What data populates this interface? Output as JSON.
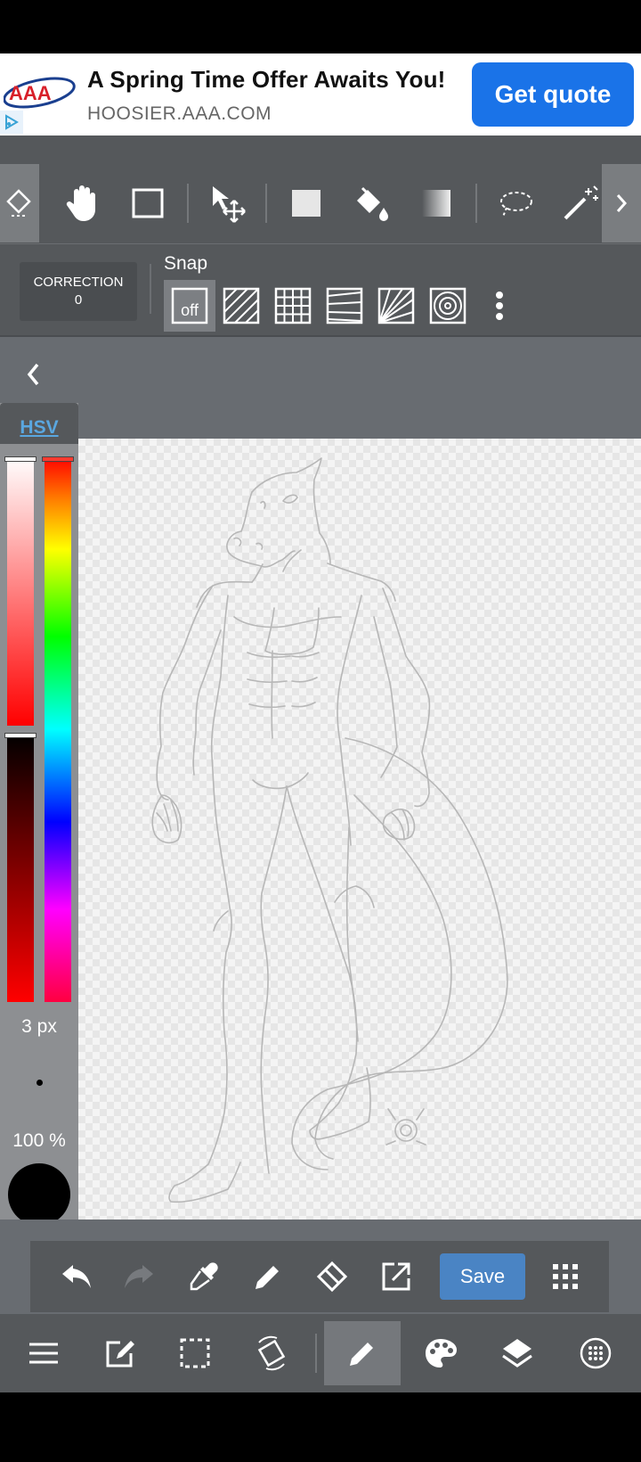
{
  "ad": {
    "title": "A Spring Time Offer Awaits You!",
    "url": "HOOSIER.AAA.COM",
    "button": "Get quote",
    "brand_color": "#1a73e8"
  },
  "toolbar": {
    "tools": [
      "hand-icon",
      "rectangle-select-icon",
      "move-icon",
      "fill-rect-icon",
      "bucket-icon",
      "gradient-icon",
      "lasso-icon",
      "magic-wand-icon"
    ]
  },
  "options": {
    "correction_label": "CORRECTION",
    "correction_value": "0",
    "snap_label": "Snap",
    "snap_off": "off"
  },
  "color_panel": {
    "mode": "HSV",
    "brush_size": "3 px",
    "opacity": "100 %",
    "current_color": "#000000"
  },
  "actions": {
    "save": "Save"
  },
  "colors": {
    "toolbar_bg": "#55585b",
    "save_button": "#4a84c4",
    "hsv_label": "#5aa7e0"
  }
}
